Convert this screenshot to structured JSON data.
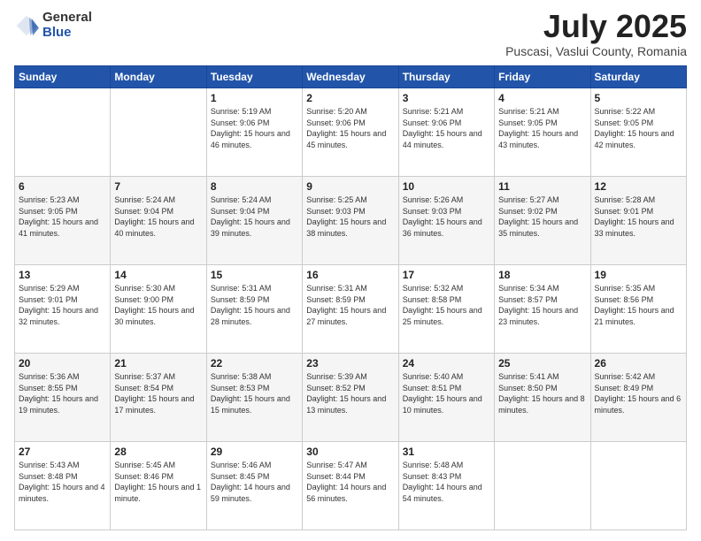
{
  "header": {
    "logo_general": "General",
    "logo_blue": "Blue",
    "title": "July 2025",
    "location": "Puscasi, Vaslui County, Romania"
  },
  "weekdays": [
    "Sunday",
    "Monday",
    "Tuesday",
    "Wednesday",
    "Thursday",
    "Friday",
    "Saturday"
  ],
  "weeks": [
    [
      {
        "day": "",
        "info": ""
      },
      {
        "day": "",
        "info": ""
      },
      {
        "day": "1",
        "info": "Sunrise: 5:19 AM\nSunset: 9:06 PM\nDaylight: 15 hours and 46 minutes."
      },
      {
        "day": "2",
        "info": "Sunrise: 5:20 AM\nSunset: 9:06 PM\nDaylight: 15 hours and 45 minutes."
      },
      {
        "day": "3",
        "info": "Sunrise: 5:21 AM\nSunset: 9:06 PM\nDaylight: 15 hours and 44 minutes."
      },
      {
        "day": "4",
        "info": "Sunrise: 5:21 AM\nSunset: 9:05 PM\nDaylight: 15 hours and 43 minutes."
      },
      {
        "day": "5",
        "info": "Sunrise: 5:22 AM\nSunset: 9:05 PM\nDaylight: 15 hours and 42 minutes."
      }
    ],
    [
      {
        "day": "6",
        "info": "Sunrise: 5:23 AM\nSunset: 9:05 PM\nDaylight: 15 hours and 41 minutes."
      },
      {
        "day": "7",
        "info": "Sunrise: 5:24 AM\nSunset: 9:04 PM\nDaylight: 15 hours and 40 minutes."
      },
      {
        "day": "8",
        "info": "Sunrise: 5:24 AM\nSunset: 9:04 PM\nDaylight: 15 hours and 39 minutes."
      },
      {
        "day": "9",
        "info": "Sunrise: 5:25 AM\nSunset: 9:03 PM\nDaylight: 15 hours and 38 minutes."
      },
      {
        "day": "10",
        "info": "Sunrise: 5:26 AM\nSunset: 9:03 PM\nDaylight: 15 hours and 36 minutes."
      },
      {
        "day": "11",
        "info": "Sunrise: 5:27 AM\nSunset: 9:02 PM\nDaylight: 15 hours and 35 minutes."
      },
      {
        "day": "12",
        "info": "Sunrise: 5:28 AM\nSunset: 9:01 PM\nDaylight: 15 hours and 33 minutes."
      }
    ],
    [
      {
        "day": "13",
        "info": "Sunrise: 5:29 AM\nSunset: 9:01 PM\nDaylight: 15 hours and 32 minutes."
      },
      {
        "day": "14",
        "info": "Sunrise: 5:30 AM\nSunset: 9:00 PM\nDaylight: 15 hours and 30 minutes."
      },
      {
        "day": "15",
        "info": "Sunrise: 5:31 AM\nSunset: 8:59 PM\nDaylight: 15 hours and 28 minutes."
      },
      {
        "day": "16",
        "info": "Sunrise: 5:31 AM\nSunset: 8:59 PM\nDaylight: 15 hours and 27 minutes."
      },
      {
        "day": "17",
        "info": "Sunrise: 5:32 AM\nSunset: 8:58 PM\nDaylight: 15 hours and 25 minutes."
      },
      {
        "day": "18",
        "info": "Sunrise: 5:34 AM\nSunset: 8:57 PM\nDaylight: 15 hours and 23 minutes."
      },
      {
        "day": "19",
        "info": "Sunrise: 5:35 AM\nSunset: 8:56 PM\nDaylight: 15 hours and 21 minutes."
      }
    ],
    [
      {
        "day": "20",
        "info": "Sunrise: 5:36 AM\nSunset: 8:55 PM\nDaylight: 15 hours and 19 minutes."
      },
      {
        "day": "21",
        "info": "Sunrise: 5:37 AM\nSunset: 8:54 PM\nDaylight: 15 hours and 17 minutes."
      },
      {
        "day": "22",
        "info": "Sunrise: 5:38 AM\nSunset: 8:53 PM\nDaylight: 15 hours and 15 minutes."
      },
      {
        "day": "23",
        "info": "Sunrise: 5:39 AM\nSunset: 8:52 PM\nDaylight: 15 hours and 13 minutes."
      },
      {
        "day": "24",
        "info": "Sunrise: 5:40 AM\nSunset: 8:51 PM\nDaylight: 15 hours and 10 minutes."
      },
      {
        "day": "25",
        "info": "Sunrise: 5:41 AM\nSunset: 8:50 PM\nDaylight: 15 hours and 8 minutes."
      },
      {
        "day": "26",
        "info": "Sunrise: 5:42 AM\nSunset: 8:49 PM\nDaylight: 15 hours and 6 minutes."
      }
    ],
    [
      {
        "day": "27",
        "info": "Sunrise: 5:43 AM\nSunset: 8:48 PM\nDaylight: 15 hours and 4 minutes."
      },
      {
        "day": "28",
        "info": "Sunrise: 5:45 AM\nSunset: 8:46 PM\nDaylight: 15 hours and 1 minute."
      },
      {
        "day": "29",
        "info": "Sunrise: 5:46 AM\nSunset: 8:45 PM\nDaylight: 14 hours and 59 minutes."
      },
      {
        "day": "30",
        "info": "Sunrise: 5:47 AM\nSunset: 8:44 PM\nDaylight: 14 hours and 56 minutes."
      },
      {
        "day": "31",
        "info": "Sunrise: 5:48 AM\nSunset: 8:43 PM\nDaylight: 14 hours and 54 minutes."
      },
      {
        "day": "",
        "info": ""
      },
      {
        "day": "",
        "info": ""
      }
    ]
  ]
}
